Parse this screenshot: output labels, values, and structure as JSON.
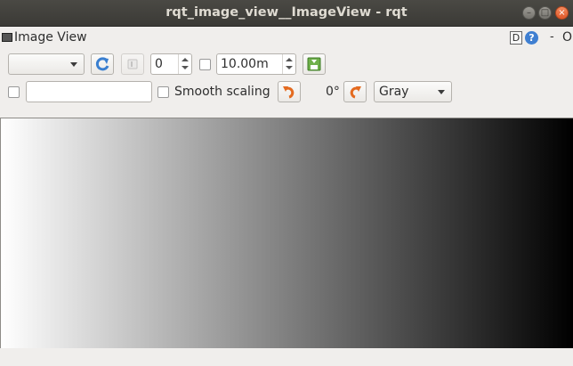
{
  "window": {
    "title": "rqt_image_view__ImageView - rqt"
  },
  "dock": {
    "title": "Image View",
    "d_button": "D",
    "help_button": "?",
    "close_dash": "-",
    "overflow": "O"
  },
  "toolbar": {
    "topic_combo_value": "",
    "spin_value": "0",
    "timeout_value": "10.00m",
    "smooth_scaling_label": "Smooth scaling",
    "rotation_value": "0°",
    "color_scheme_value": "Gray",
    "topic_input_value": ""
  },
  "image": {
    "description_colors": {
      "left": "#ffffff",
      "right": "#000000"
    }
  },
  "icons": [
    "refresh-icon",
    "pause-icon",
    "save-icon",
    "rotate-left-icon",
    "rotate-right-icon"
  ]
}
